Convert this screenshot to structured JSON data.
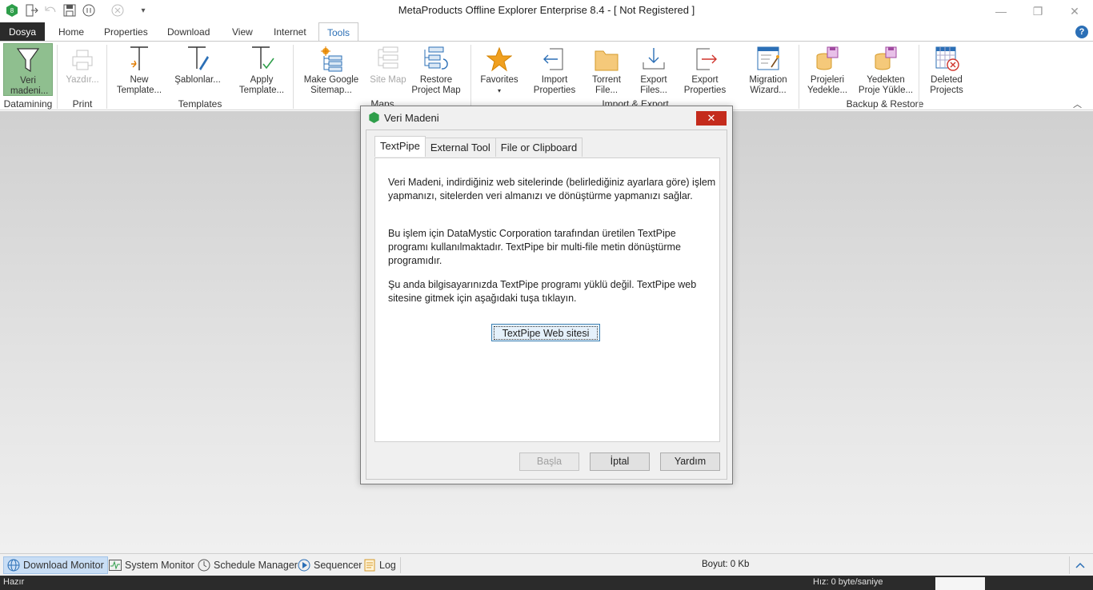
{
  "window": {
    "title": "MetaProducts Offline Explorer Enterprise 8.4 - [ Not Registered ]",
    "minimize": "—",
    "restore": "❐",
    "close": "✕"
  },
  "ribbon_tabs": {
    "file": "Dosya",
    "home": "Home",
    "properties": "Properties",
    "download": "Download",
    "view": "View",
    "internet": "Internet",
    "tools": "Tools",
    "help": "?"
  },
  "ribbon": {
    "veri_madeni": "Veri madeni...",
    "yazdir": "Yazdır...",
    "new_template": "New Template...",
    "sablonlar": "Şablonlar...",
    "apply_template": "Apply Template...",
    "make_google_sitemap": "Make Google Sitemap...",
    "site_map": "Site Map",
    "restore_project_map": "Restore Project Map",
    "favorites": "Favorites",
    "import_properties": "Import Properties",
    "torrent_file": "Torrent File...",
    "export_files": "Export Files...",
    "export_properties": "Export Properties",
    "migration_wizard": "Migration Wizard...",
    "projeleri_yedekle": "Projeleri Yedekle...",
    "yedekten_proje_yukle": "Yedekten Proje Yükle...",
    "deleted_projects": "Deleted Projects",
    "groups": {
      "datamining": "Datamining",
      "print": "Print",
      "templates": "Templates",
      "maps": "Maps",
      "import_export": "Import & Export",
      "backup_restore": "Backup & Restore"
    }
  },
  "dialog": {
    "title": "Veri Madeni",
    "close": "✕",
    "tabs": [
      "TextPipe",
      "External Tool",
      "File or Clipboard"
    ],
    "para1": "Veri Madeni, indirdiğiniz web sitelerinde (belirlediğiniz ayarlara göre) işlem yapmanızı, sitelerden veri almanızı ve dönüştürme yapmanızı sağlar.",
    "para2": "Bu işlem için DataMystic Corporation tarafından üretilen TextPipe programı kullanılmaktadır. TextPipe bir multi-file metin dönüştürme programıdır.",
    "para3": "Şu anda bilgisayarınızda TextPipe programı yüklü değil. TextPipe web sitesine gitmek için aşağıdaki tuşa tıklayın.",
    "web_button": "TextPipe Web sitesi",
    "basla": "Başla",
    "iptal": "İptal",
    "yardim": "Yardım"
  },
  "bottom": {
    "download_monitor": "Download Monitor",
    "system_monitor": "System Monitor",
    "schedule_manager": "Schedule Manager",
    "sequencer": "Sequencer",
    "log": "Log",
    "size": "Boyut: 0 Kb"
  },
  "status": {
    "ready": "Hazır",
    "speed": "Hız: 0 byte/saniye"
  },
  "colors": {
    "accent": "#2b6fb6",
    "file_tab": "#2b2b2b",
    "selected_tool": "#8fbf8f",
    "close_red": "#c42b1c"
  }
}
